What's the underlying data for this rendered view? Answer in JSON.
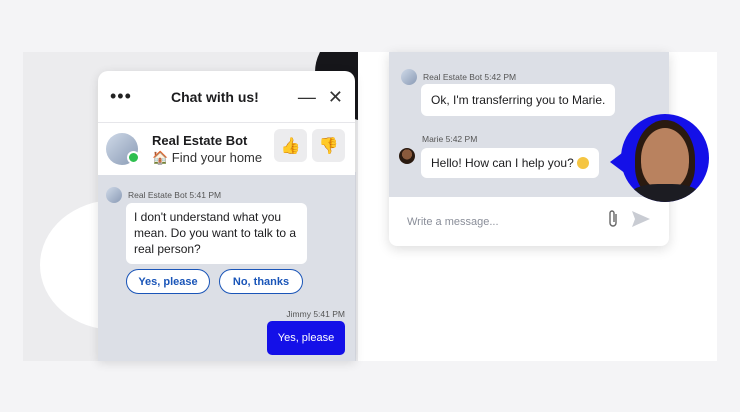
{
  "left_widget": {
    "menu_label": "•••",
    "title": "Chat with us!",
    "minimize_label": "—",
    "close_label": "✕",
    "bot_name": "Real Estate Bot",
    "bot_subtitle": "🏠 Find your home",
    "thumbs_up_label": "👍",
    "thumbs_down_label": "👎",
    "messages": [
      {
        "sender": "Real Estate Bot",
        "time": "5:41 PM",
        "meta": "Real Estate Bot 5:41 PM",
        "text": "I don't understand what you mean. Do you want to talk to a real person?"
      },
      {
        "sender": "Jimmy",
        "time": "5:41 PM",
        "meta": "Jimmy 5:41 PM",
        "text": "Yes, please"
      }
    ],
    "quick_replies": [
      "Yes, please",
      "No, thanks"
    ]
  },
  "right_widget": {
    "messages": [
      {
        "sender": "Real Estate Bot",
        "time": "5:42 PM",
        "meta": "Real Estate Bot 5:42 PM",
        "text": "Ok, I'm transferring you to Marie."
      },
      {
        "sender": "Marie",
        "time": "5:42 PM",
        "meta": "Marie 5:42 PM",
        "text": "Hello! How can I help you?"
      }
    ],
    "input_placeholder": "Write a message...",
    "attach_icon": "paperclip-icon",
    "send_icon": "send-icon"
  },
  "colors": {
    "accent": "#1410e8",
    "button_outline": "#1a55b8",
    "online": "#2fbf4f",
    "chat_background": "#dcdfe6"
  }
}
